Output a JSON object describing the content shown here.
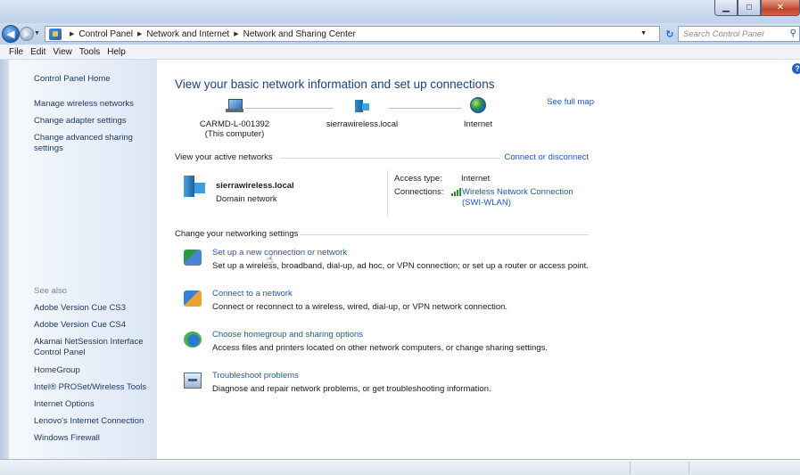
{
  "address": {
    "crumbs": [
      "Control Panel",
      "Network and Internet",
      "Network and Sharing Center"
    ],
    "search_placeholder": "Search Control Panel"
  },
  "menu": [
    "File",
    "Edit",
    "View",
    "Tools",
    "Help"
  ],
  "sidebar": {
    "home": "Control Panel Home",
    "links": [
      "Manage wireless networks",
      "Change adapter settings",
      "Change advanced sharing settings"
    ],
    "see_also_label": "See also",
    "see_also": [
      "Adobe Version Cue CS3",
      "Adobe Version Cue CS4",
      "Akamai NetSession Interface Control Panel",
      "HomeGroup",
      "Intel® PROSet/Wireless Tools",
      "Internet Options",
      "Lenovo's Internet Connection",
      "Windows Firewall"
    ]
  },
  "main": {
    "title": "View your basic network information and set up connections",
    "see_full_map": "See full map",
    "map": {
      "computer_name": "CARMD-L-001392",
      "computer_sub": "(This computer)",
      "network": "sierrawireless.local",
      "internet": "Internet"
    },
    "active_section": "View your active networks",
    "connect_disconnect": "Connect or disconnect",
    "active_network": {
      "name": "sierrawireless.local",
      "type": "Domain network",
      "access_type_label": "Access type:",
      "access_type": "Internet",
      "connections_label": "Connections:",
      "connection_name": "Wireless Network Connection",
      "connection_ssid": "(SWI-WLAN)"
    },
    "change_section": "Change your networking settings",
    "tasks": [
      {
        "title": "Set up a new connection or network",
        "desc": "Set up a wireless, broadband, dial-up, ad hoc, or VPN connection; or set up a router or access point."
      },
      {
        "title": "Connect to a network",
        "desc": "Connect or reconnect to a wireless, wired, dial-up, or VPN network connection."
      },
      {
        "title": "Choose homegroup and sharing options",
        "desc": "Access files and printers located on other network computers, or change sharing settings."
      },
      {
        "title": "Troubleshoot problems",
        "desc": "Diagnose and repair network problems, or get troubleshooting information."
      }
    ]
  }
}
